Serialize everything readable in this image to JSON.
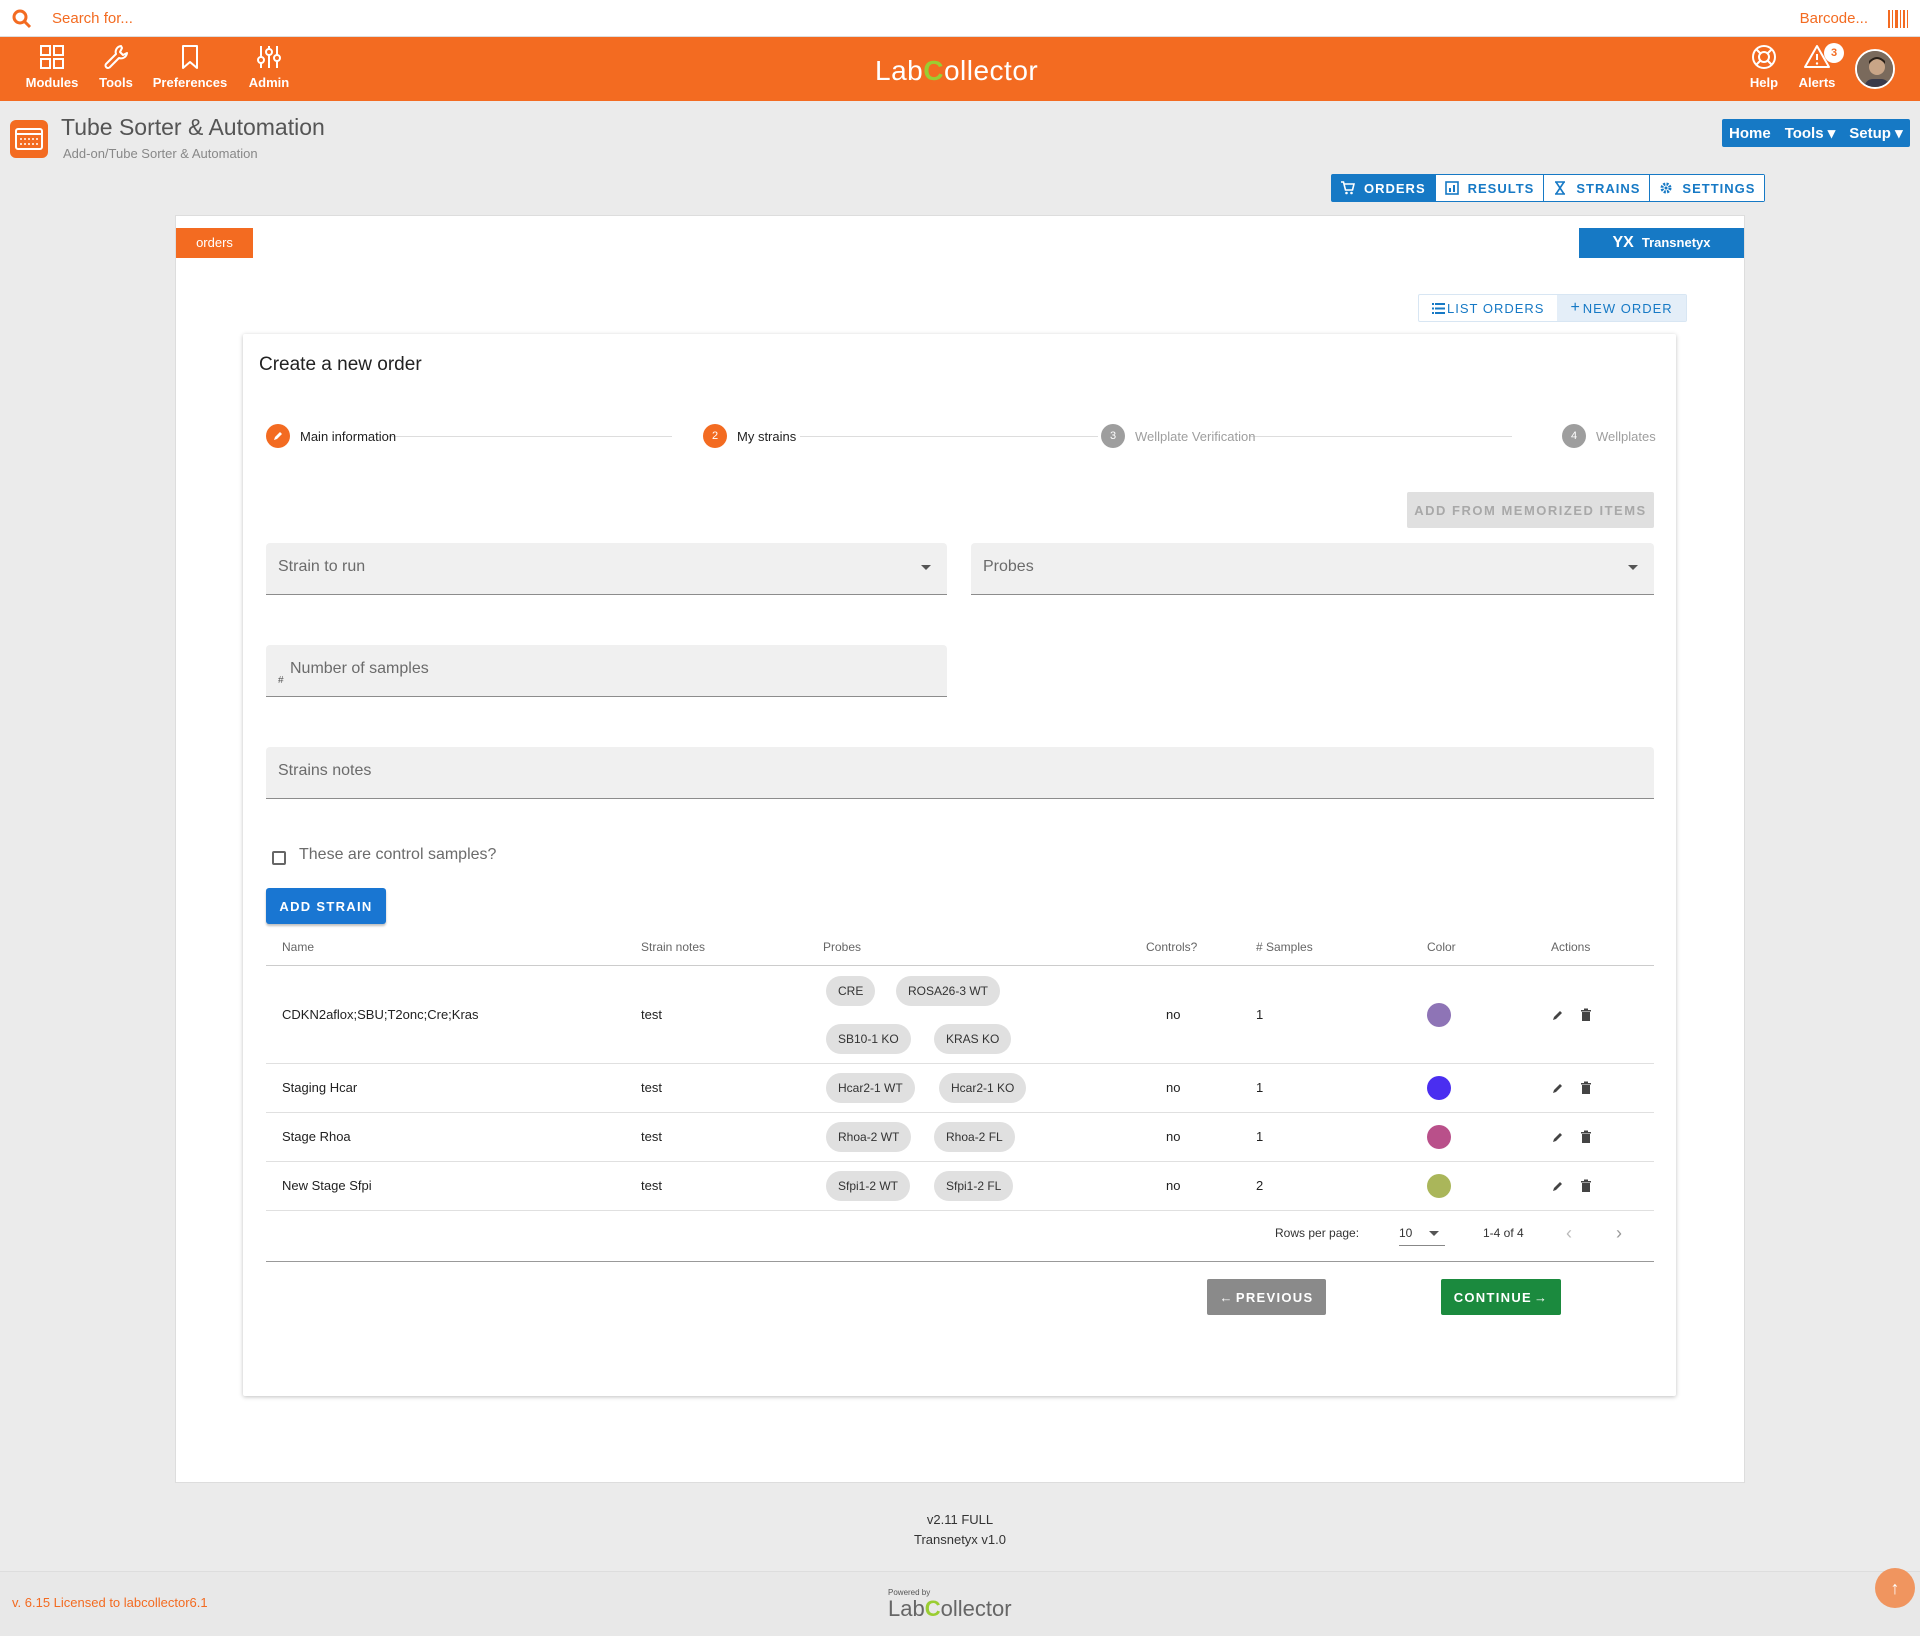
{
  "topbar": {
    "search_placeholder": "Search for...",
    "barcode_label": "Barcode..."
  },
  "nav": {
    "items": [
      {
        "label": "Modules",
        "icon": "grid-icon"
      },
      {
        "label": "Tools",
        "icon": "wrench-icon"
      },
      {
        "label": "Preferences",
        "icon": "bookmark-icon"
      },
      {
        "label": "Admin",
        "icon": "sliders-icon"
      }
    ],
    "logo_prefix": "Lab",
    "logo_c": "C",
    "logo_suffix": "ollector",
    "help_label": "Help",
    "alerts_label": "Alerts",
    "alerts_count": "3"
  },
  "page": {
    "title": "Tube Sorter & Automation",
    "subtitle": "Add-on/Tube Sorter & Automation",
    "menu": [
      "Home",
      "Tools ▾",
      "Setup ▾"
    ]
  },
  "tabs": [
    "ORDERS",
    "RESULTS",
    "STRAINS",
    "SETTINGS"
  ],
  "panel": {
    "orders_tag": "orders",
    "transnetyx_mark": "YX",
    "transnetyx_label": "Transnetyx",
    "list_orders": "LIST ORDERS",
    "new_order": "NEW ORDER"
  },
  "card": {
    "title": "Create a new order",
    "steps": [
      {
        "num": "",
        "label": "Main information"
      },
      {
        "num": "2",
        "label": "My strains"
      },
      {
        "num": "3",
        "label": "Wellplate Verification"
      },
      {
        "num": "4",
        "label": "Wellplates"
      }
    ],
    "memo_button": "ADD FROM MEMORIZED ITEMS",
    "strain_placeholder": "Strain to run",
    "probes_placeholder": "Probes",
    "samples_hash": "#",
    "samples_placeholder": "Number of samples",
    "notes_placeholder": "Strains notes",
    "control_label": "These are control samples?",
    "add_strain": "ADD STRAIN"
  },
  "table": {
    "headers": [
      "Name",
      "Strain notes",
      "Probes",
      "Controls?",
      "# Samples",
      "Color",
      "Actions"
    ],
    "rows": [
      {
        "name": "CDKN2aflox;SBU;T2onc;Cre;Kras",
        "notes": "test",
        "probes": [
          "CRE",
          "ROSA26-3 WT",
          "SB10-1 KO",
          "KRAS KO"
        ],
        "controls": "no",
        "samples": "1",
        "color": "#8e74b6"
      },
      {
        "name": "Staging Hcar",
        "notes": "test",
        "probes": [
          "Hcar2-1 WT",
          "Hcar2-1 KO"
        ],
        "controls": "no",
        "samples": "1",
        "color": "#4a2ef0"
      },
      {
        "name": "Stage Rhoa",
        "notes": "test",
        "probes": [
          "Rhoa-2 WT",
          "Rhoa-2 FL"
        ],
        "controls": "no",
        "samples": "1",
        "color": "#b9508a"
      },
      {
        "name": "New Stage Sfpi",
        "notes": "test",
        "probes": [
          "Sfpi1-2 WT",
          "Sfpi1-2 FL"
        ],
        "controls": "no",
        "samples": "2",
        "color": "#aab65a"
      }
    ],
    "rows_per_page_label": "Rows per page:",
    "rows_per_page": "10",
    "range": "1-4 of 4"
  },
  "buttons": {
    "previous": "PREVIOUS",
    "continue": "CONTINUE"
  },
  "version": {
    "line1": "v2.11 FULL",
    "line2": "Transnetyx v1.0"
  },
  "footer": {
    "license": "v. 6.15 Licensed to labcollector6.1",
    "powered_by": "Powered by",
    "logo_prefix": "Lab",
    "logo_c": "C",
    "logo_suffix": "ollector"
  },
  "colors": {
    "brand_orange": "#f36b21",
    "primary_blue": "#1679c5",
    "success_green": "#1b8a3e"
  }
}
